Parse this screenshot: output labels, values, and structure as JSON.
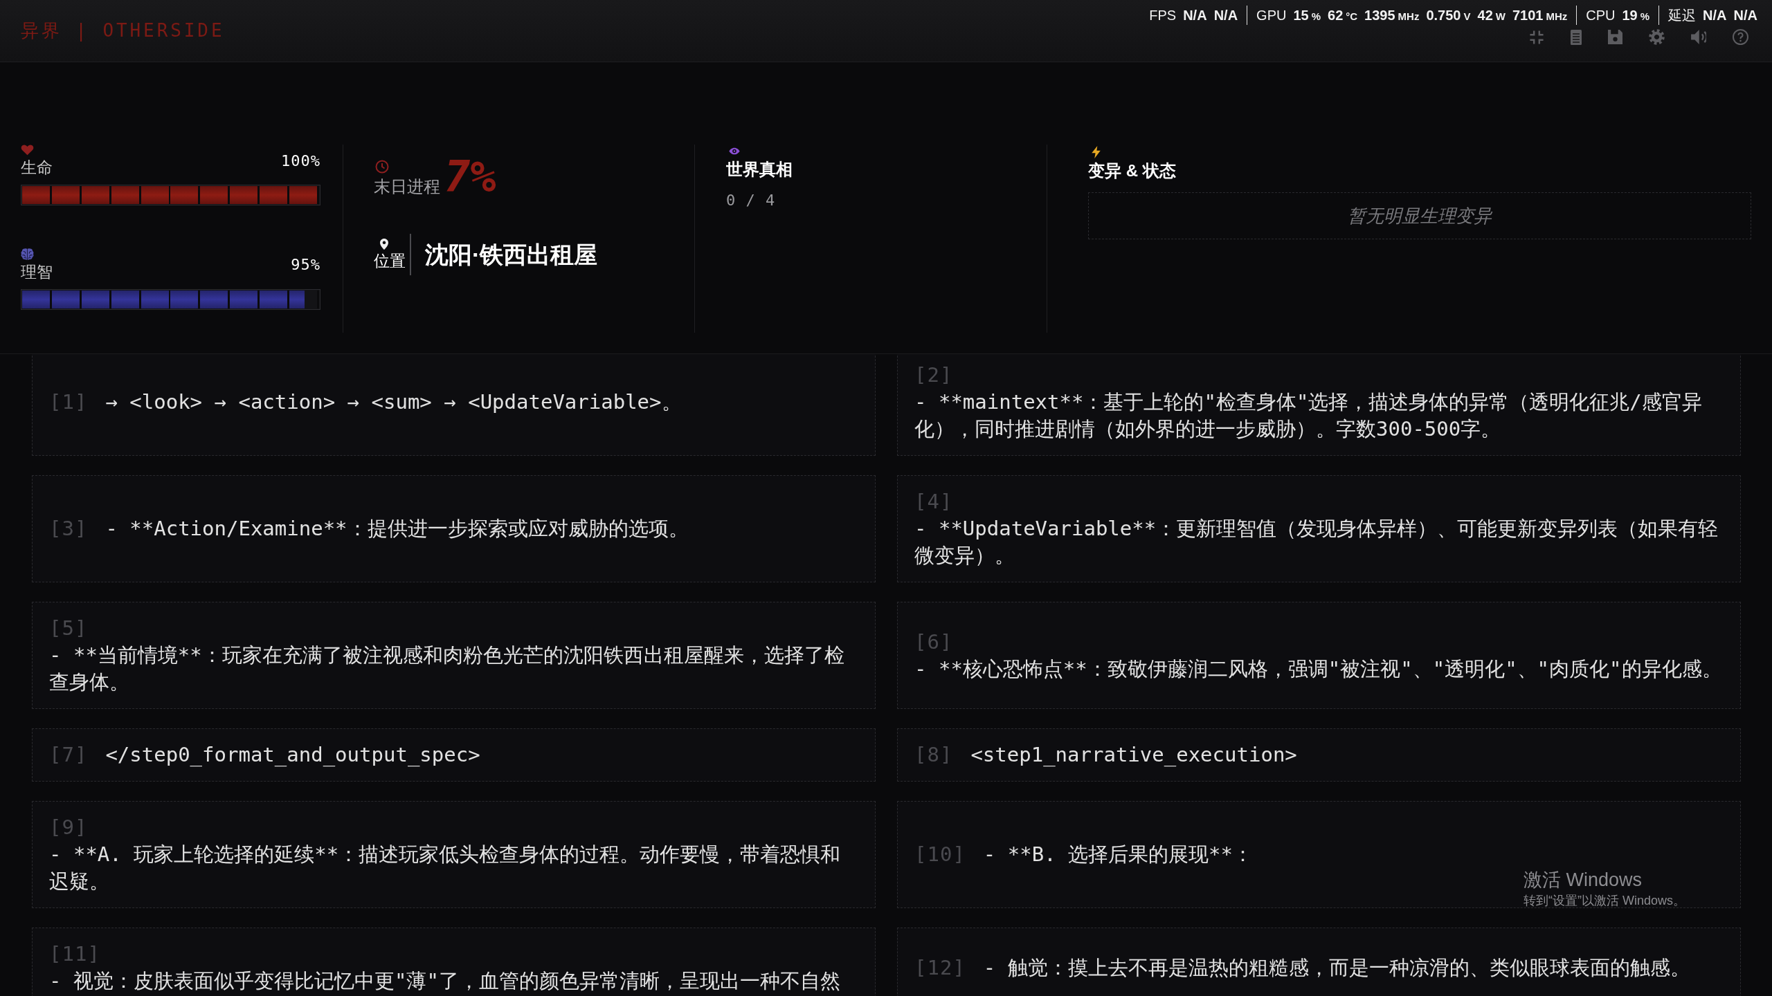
{
  "header": {
    "title": "异界 | OTHERSIDE"
  },
  "performance_overlay": [
    {
      "label": "FPS",
      "readings": [
        {
          "value": "N/A"
        },
        {
          "value": "N/A"
        }
      ]
    },
    {
      "label": "GPU",
      "readings": [
        {
          "value": "15",
          "unit": "%"
        },
        {
          "value": "62",
          "unit": "°C"
        },
        {
          "value": "1395",
          "unit": "MHz"
        },
        {
          "value": "0.750",
          "unit": "V"
        },
        {
          "value": "42",
          "unit": "W"
        },
        {
          "value": "7101",
          "unit": "MHz"
        }
      ]
    },
    {
      "label": "CPU",
      "readings": [
        {
          "value": "19",
          "unit": "%"
        }
      ]
    },
    {
      "label": "延迟",
      "readings": [
        {
          "value": "N/A"
        },
        {
          "value": "N/A"
        }
      ]
    }
  ],
  "status": {
    "vitals": [
      {
        "kind": "health",
        "label": "生命",
        "reading": "100%",
        "level": 1
      },
      {
        "kind": "sanity",
        "label": "理智",
        "reading": "95%",
        "level": 0.95
      }
    ],
    "doom": {
      "label": "末日进程",
      "value": "7%"
    },
    "location": {
      "label": "位置",
      "value": "沈阳·铁西出租屋"
    },
    "truth": {
      "title": "世界真相",
      "count": "0 / 4"
    },
    "mutations": {
      "title": "变异 & 状态",
      "empty_text": "暂无明显生理变异"
    }
  },
  "card_rows": [
    {
      "cells": [
        {
          "index": "[1]",
          "text": "→ <look> → <action> → <sum> → <UpdateVariable>。"
        },
        {
          "index": "[2]",
          "text": "- **maintext**：基于上轮的\"检查身体\"选择，描述身体的异常（透明化征兆/感官异化），同时推进剧情（如外界的进一步威胁）。字数300-500字。"
        }
      ]
    },
    {
      "cells": [
        {
          "index": "[3]",
          "text": "- **Action/Examine**：提供进一步探索或应对威胁的选项。"
        },
        {
          "index": "[4]",
          "text": "- **UpdateVariable**：更新理智值（发现身体异样）、可能更新变异列表（如果有轻微变异）。"
        }
      ]
    },
    {
      "cells": [
        {
          "index": "[5]",
          "text": "- **当前情境**：玩家在充满了被注视感和肉粉色光芒的沈阳铁西出租屋醒来，选择了检查身体。"
        },
        {
          "index": "[6]",
          "text": "- **核心恐怖点**：致敬伊藤润二风格，强调\"被注视\"、\"透明化\"、\"肉质化\"的异化感。"
        }
      ]
    },
    {
      "cells": [
        {
          "index": "[7]",
          "text": "</step0_format_and_output_spec>"
        },
        {
          "index": "[8]",
          "text": "<step1_narrative_execution>"
        }
      ]
    },
    {
      "cells": [
        {
          "index": "[9]",
          "text": "- **A. 玩家上轮选择的延续**：描述玩家低头检查身体的过程。动作要慢，带着恐惧和迟疑。"
        },
        {
          "index": "[10]",
          "text": "- **B. 选择后果的展现**："
        }
      ]
    },
    {
      "cells": [
        {
          "index": "[11]",
          "text": "- 视觉：皮肤表面似乎变得比记忆中更\"薄\"了，血管的颜色异常清晰，呈现出一种不自然"
        },
        {
          "index": "[12]",
          "text": "- 触觉：摸上去不再是温热的粗糙感，而是一种凉滑的、类似眼球表面的触感。"
        }
      ]
    }
  ],
  "system_notice": {
    "title": "激活 Windows",
    "text": "转到“设置”以激活 Windows。"
  }
}
